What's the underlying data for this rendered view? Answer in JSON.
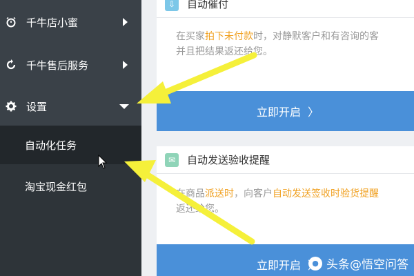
{
  "sidebar": {
    "items": [
      {
        "label": "千牛店小蜜",
        "icon": "alarm-clock-icon"
      },
      {
        "label": "千牛售后服务",
        "icon": "refresh-icon"
      },
      {
        "label": "设置",
        "icon": "gear-icon"
      }
    ],
    "sub_items": [
      {
        "label": "自动化任务",
        "active": true
      },
      {
        "label": "淘宝现金红包",
        "active": false
      }
    ]
  },
  "main": {
    "panels": [
      {
        "title": "自动催付",
        "icon": "shield-download-icon",
        "desc_line1_pre": "在买家",
        "desc_line1_hl": "拍下未付款",
        "desc_line1_post": "时，对静默客户和有咨询的客",
        "desc_line2": "并且把结果返还给您。",
        "button": "立即开启"
      },
      {
        "title": "自动发送验收提醒",
        "icon": "envelope-icon",
        "desc_line1_pre": "在商品",
        "desc_line1_hl": "派送时",
        "desc_line1_mid": "，向客户",
        "desc_line1_hl2": "自动发送签收时验货提醒",
        "desc_line2": "返还给您。",
        "button": "立即开启"
      }
    ]
  },
  "watermark": "头条@悟空问答",
  "colors": {
    "sidebar": "#3a4148",
    "button": "#4a90d9",
    "highlight": "#f0a020",
    "arrow": "#f5f03a"
  }
}
